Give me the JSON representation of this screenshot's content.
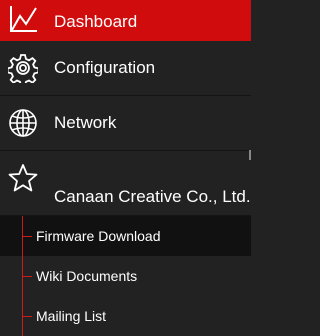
{
  "menu": {
    "items": [
      {
        "label": "Dashboard",
        "icon": "chart-line-icon",
        "active": true
      },
      {
        "label": "Configuration",
        "icon": "gear-icon"
      },
      {
        "label": "Network",
        "icon": "globe-icon"
      },
      {
        "label": "Canaan Creative Co., Ltd.",
        "icon": "star-icon",
        "expanded": true
      }
    ],
    "subitems": [
      {
        "label": "Firmware Download",
        "active": true
      },
      {
        "label": "Wiki Documents"
      },
      {
        "label": "Mailing List"
      }
    ]
  },
  "colors": {
    "background": "#222222",
    "active": "#d00c0c",
    "accent_line": "#cc1b1b",
    "text": "#ffffff"
  }
}
